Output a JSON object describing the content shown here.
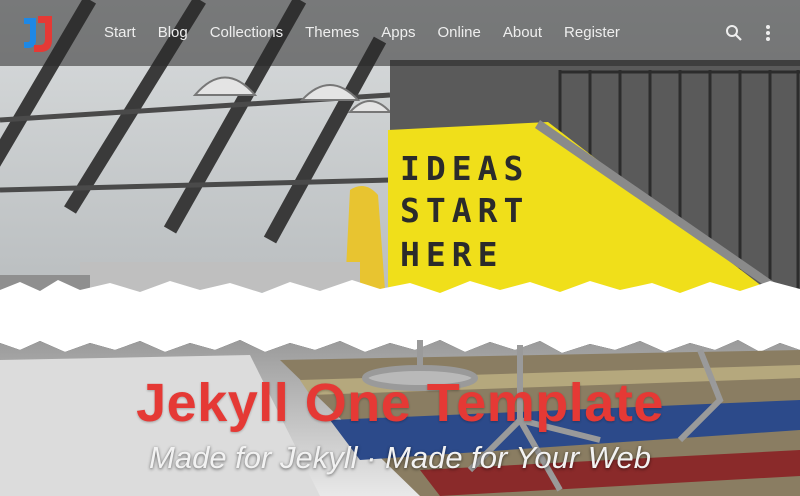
{
  "navbar": {
    "logo_icon": "j1-logo-icon",
    "items": [
      {
        "label": "Start"
      },
      {
        "label": "Blog"
      },
      {
        "label": "Collections"
      },
      {
        "label": "Themes"
      },
      {
        "label": "Apps"
      },
      {
        "label": "Online"
      },
      {
        "label": "About"
      },
      {
        "label": "Register"
      }
    ],
    "search_icon": "search-icon",
    "menu_icon": "more-vert-icon"
  },
  "hero": {
    "sign_lines": [
      "IDEAS",
      "START",
      "HERE"
    ],
    "title": "Jekyll One Template",
    "subtitle": "Made for Jekyll · Made for Your Web",
    "title_color": "#e53935",
    "sign_color": "#f0df1a"
  }
}
